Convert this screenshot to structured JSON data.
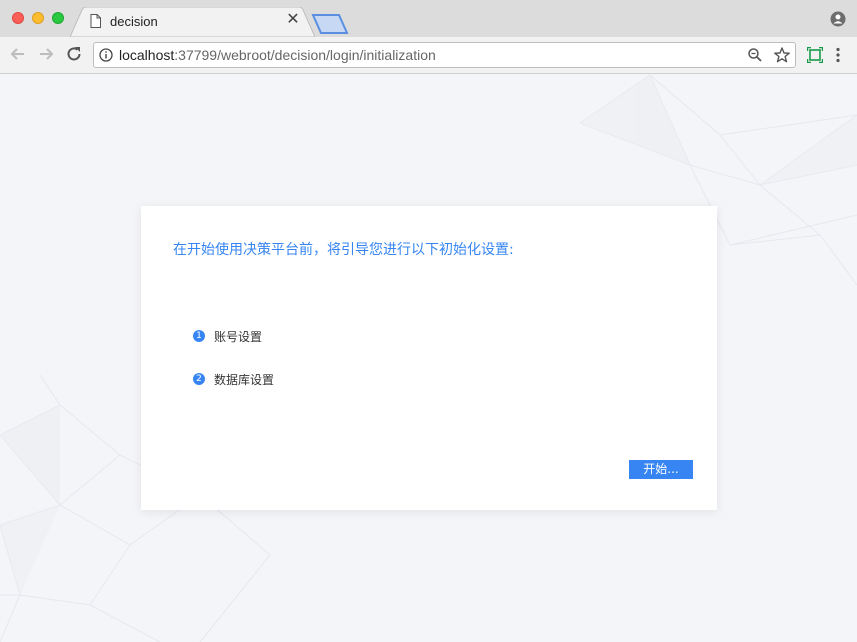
{
  "browser": {
    "tab_title": "decision",
    "url_host": "localhost",
    "url_rest": ":37799/webroot/decision/login/initialization",
    "icons": [
      "page-icon",
      "close-icon",
      "new-tab-icon",
      "profile-icon",
      "back-icon",
      "forward-icon",
      "reload-icon",
      "info-icon",
      "zoom-icon",
      "star-icon",
      "extension-icon",
      "menu-icon"
    ]
  },
  "card": {
    "title": "在开始使用决策平台前，将引导您进行以下初始化设置:",
    "steps": [
      {
        "num": "1",
        "label": "账号设置"
      },
      {
        "num": "2",
        "label": "数据库设置"
      }
    ],
    "start_button": "开始..."
  },
  "colors": {
    "accent": "#3685f2",
    "page_bg": "#f4f5f8",
    "card_bg": "#ffffff"
  }
}
